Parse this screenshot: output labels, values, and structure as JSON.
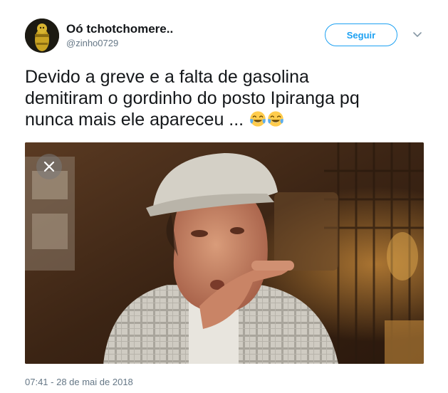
{
  "author": {
    "display_name": "Oó tchotchomere..",
    "handle": "@zinho0729"
  },
  "follow_button": {
    "label": "Seguir"
  },
  "tweet": {
    "lines": [
      "Devido a greve e a falta de gasolina",
      "demitiram o gordinho do posto Ipiranga pq",
      "nunca mais ele apareceu ..."
    ],
    "emoji": [
      "face-with-tears-of-joy",
      "face-with-tears-of-joy"
    ]
  },
  "media": {
    "dismiss_icon": "close-icon"
  },
  "timestamp": "07:41 - 28 de mai de 2018",
  "colors": {
    "accent": "#1da1f2",
    "text": "#14171a",
    "secondary": "#657786"
  }
}
